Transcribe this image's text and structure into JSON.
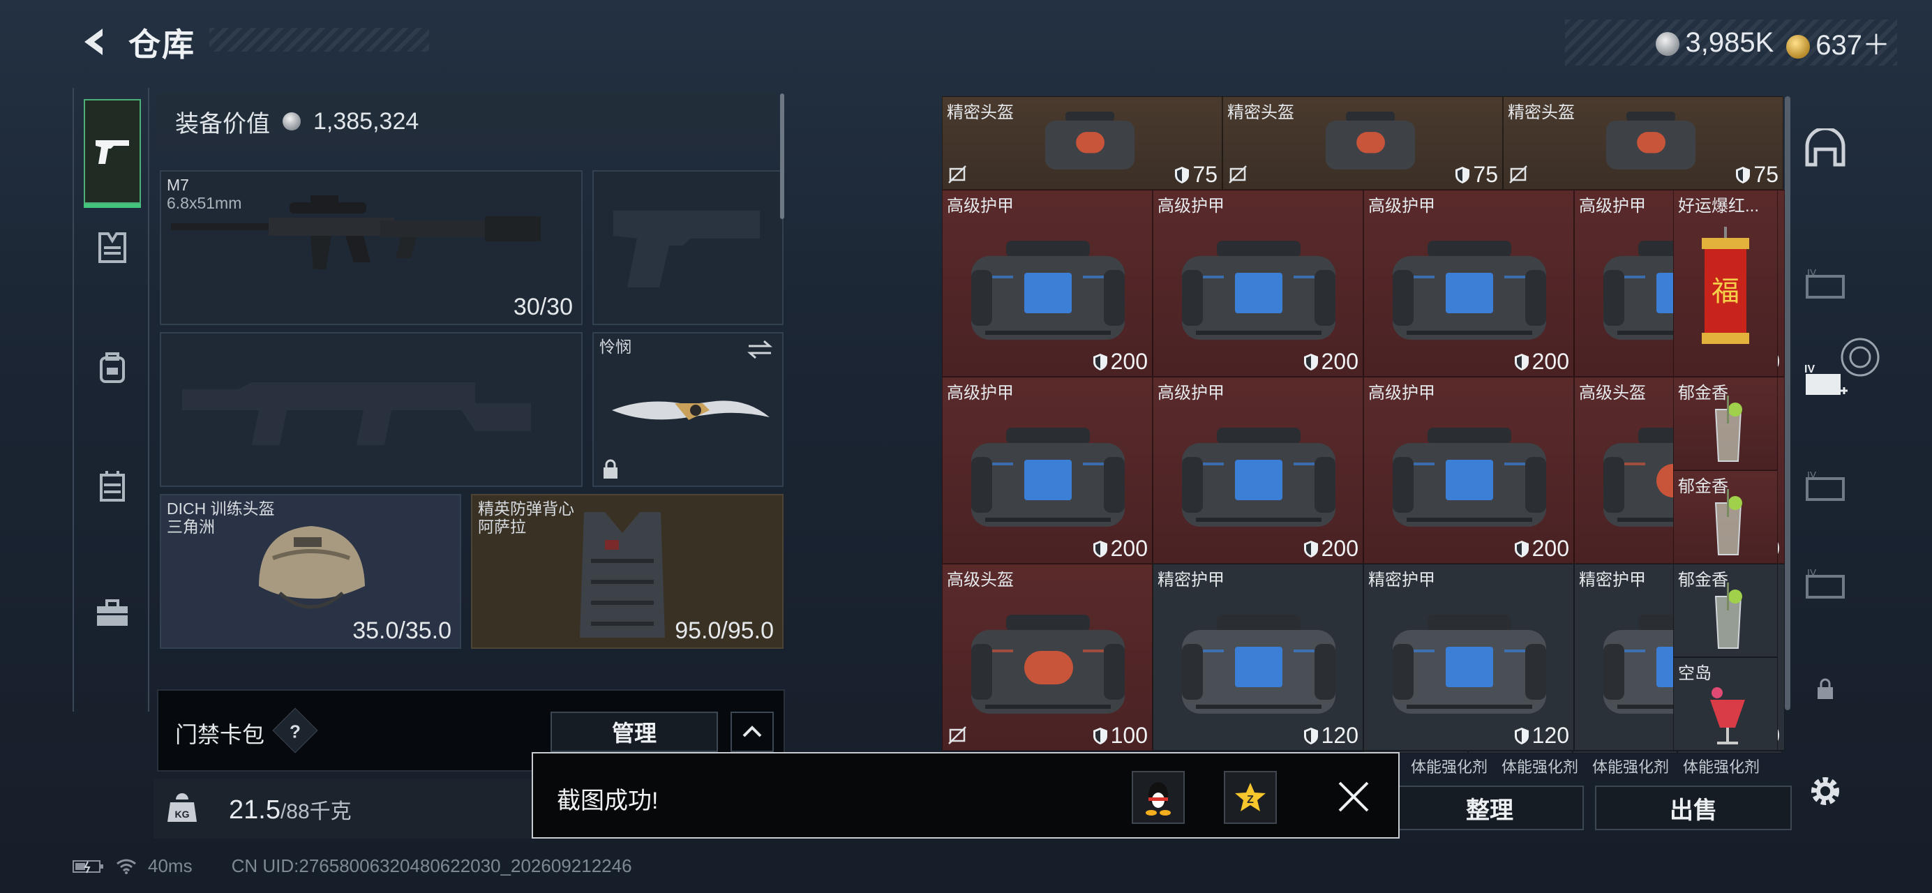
{
  "header": {
    "title": "仓库",
    "currency_silver": "3,985K",
    "currency_gold": "637＋"
  },
  "rail": {
    "items": [
      "weapons",
      "gear",
      "backpack",
      "rig",
      "case"
    ]
  },
  "equipment": {
    "value_label": "装备价值",
    "value": "1,385,324",
    "primary": {
      "name": "M7",
      "caliber": "6.8x51mm",
      "ammo": "30/30"
    },
    "melee": {
      "name": "怜悯"
    },
    "helmet": {
      "name": "DICH 训练头盔",
      "sub": "三角洲",
      "durability": "35.0/35.0"
    },
    "armor": {
      "name": "精英防弹背心",
      "sub": "阿萨拉",
      "durability": "95.0/95.0"
    },
    "keycard_label": "门禁卡包",
    "keycard_help": "?",
    "manage_label": "管理",
    "weight_value": "21.5",
    "weight_capacity": "/88千克"
  },
  "status": {
    "ping": "40ms",
    "uid": "CN UID:27658006320480622030_202609212246"
  },
  "grid": {
    "rows": [
      [
        {
          "label": "精密头盔",
          "dur": "75"
        },
        {
          "label": "精密头盔",
          "dur": "75"
        },
        {
          "label": "精密头盔",
          "dur": "75"
        }
      ],
      [
        {
          "label": "高级护甲",
          "dur": "200"
        },
        {
          "label": "高级护甲",
          "dur": "200"
        },
        {
          "label": "高级护甲",
          "dur": "200"
        },
        {
          "label": "高级护甲",
          "dur": "200"
        },
        {
          "label": "好运爆红..."
        }
      ],
      [
        {
          "label": "高级护甲",
          "dur": "200"
        },
        {
          "label": "高级护甲",
          "dur": "200"
        },
        {
          "label": "高级护甲",
          "dur": "200"
        },
        {
          "label": "高级头盔",
          "dur": "100"
        },
        {
          "label": "郁金香"
        }
      ],
      [
        {
          "label": "郁金香"
        }
      ],
      [
        {
          "label": "高级头盔",
          "dur": "100"
        },
        {
          "label": "精密护甲",
          "dur": "120"
        },
        {
          "label": "精密护甲",
          "dur": "120"
        },
        {
          "label": "精密护甲",
          "dur": "120"
        },
        {
          "label": "郁金香"
        }
      ],
      [
        {
          "label": "空岛"
        }
      ]
    ],
    "bottom_labels": [
      "体能强化剂",
      "体能强化剂",
      "体能强化剂",
      "体能强化剂"
    ],
    "sort_label": "整理",
    "sell_label": "出售"
  },
  "toast": {
    "text": "截图成功!"
  },
  "colors": {
    "accent_green": "#45c47d",
    "brown_cell": "#4a3a2e",
    "red_cell": "#5a2a2b"
  }
}
